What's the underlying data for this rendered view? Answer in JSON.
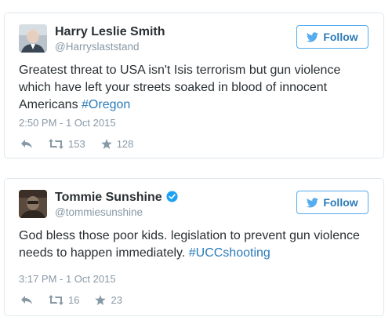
{
  "tweets": [
    {
      "display_name": "Harry Leslie Smith",
      "username": "@Harryslaststand",
      "verified": false,
      "follow_label": "Follow",
      "text_plain": "Greatest threat to USA isn't Isis  terrorism but gun violence which have left your streets soaked in blood of innocent Americans ",
      "hashtag": "#Oregon",
      "timestamp": "2:50 PM - 1 Oct 2015",
      "retweets": "153",
      "likes": "128"
    },
    {
      "display_name": "Tommie Sunshine",
      "username": "@tommiesunshine",
      "verified": true,
      "follow_label": "Follow",
      "text_plain": "God bless those poor kids. legislation to prevent gun violence needs to happen immediately. ",
      "hashtag": "#UCCshooting",
      "timestamp": "3:17 PM - 1 Oct 2015",
      "retweets": "16",
      "likes": "23"
    }
  ],
  "colors": {
    "link": "#2b7bb9",
    "follow_border": "#55acee",
    "muted": "#8899a6",
    "verified": "#1da1f2",
    "card_border": "#e1e8ed"
  }
}
